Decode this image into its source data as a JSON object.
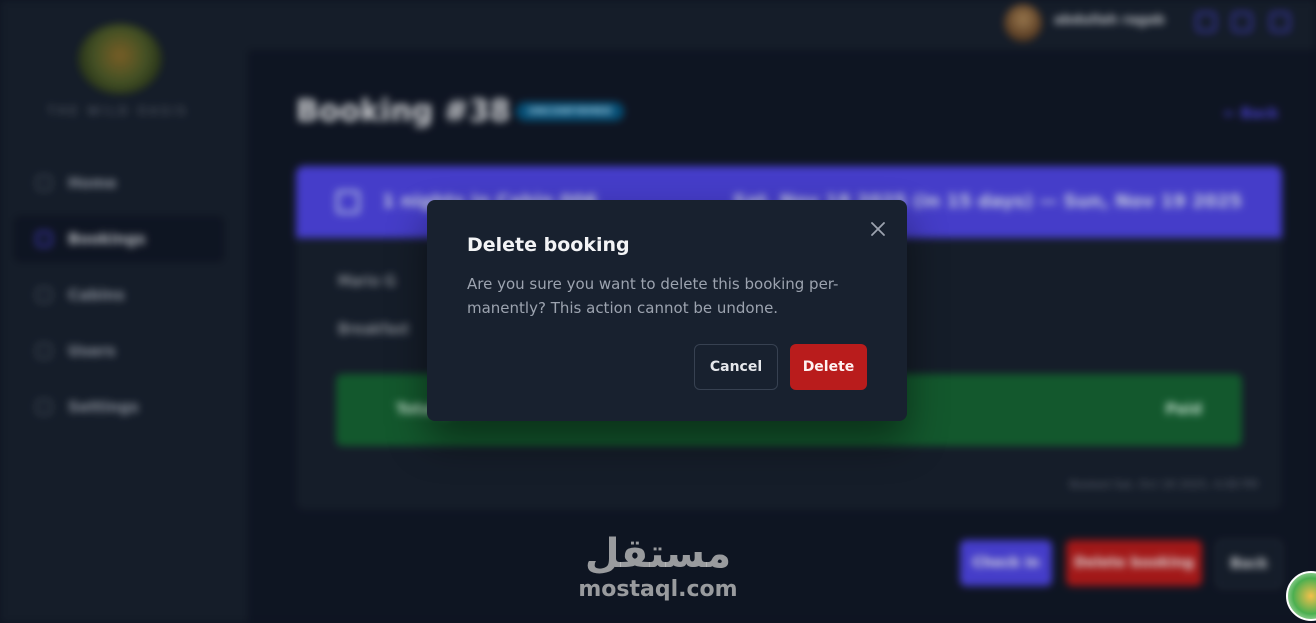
{
  "app": {
    "brand": "THE WILD OASIS",
    "user_name": "abdullah ragab"
  },
  "sidebar": {
    "items": [
      {
        "label": "Home"
      },
      {
        "label": "Bookings"
      },
      {
        "label": "Cabins"
      },
      {
        "label": "Users"
      },
      {
        "label": "Settings"
      }
    ]
  },
  "booking": {
    "title": "Booking #38",
    "status": "unconfirmed",
    "back_link": "← Back",
    "nights": "1 nights in Cabin 006",
    "dates": "Sat, Nov 18 2025 (in 15 days) — Sun, Nov 19 2025",
    "guest": "Mario G",
    "breakfast": "Breakfast",
    "price_label": "Total price",
    "price_status": "Paid",
    "booked_date": "Booked Sat, Oct 18 2025, 4:08 PM",
    "actions": {
      "check_in": "Check in",
      "delete": "Delete booking",
      "back": "Back"
    }
  },
  "modal": {
    "title": "Delete booking",
    "message": "Are you sure you want to delete this booking per-manently? This action cannot be undone.",
    "cancel_label": "Cancel",
    "delete_label": "Delete"
  },
  "watermark": {
    "arabic": "مستقل",
    "latin": "mostaql.com"
  },
  "colors": {
    "accent": "#4f46e5",
    "danger": "#b91c1c",
    "success": "#166534",
    "background": "#111827",
    "surface": "#18212f"
  }
}
